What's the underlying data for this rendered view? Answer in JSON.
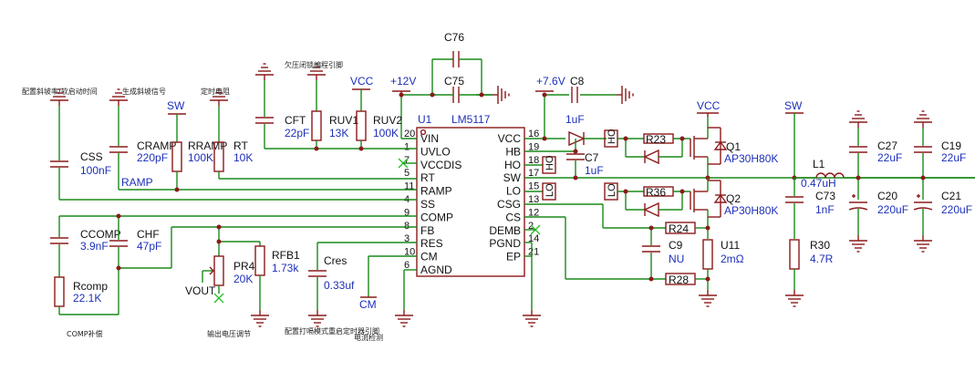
{
  "ic": {
    "ref": "U1",
    "part": "LM5117",
    "left_pins": [
      {
        "num": "20",
        "name": "VIN"
      },
      {
        "num": "1",
        "name": "UVLO"
      },
      {
        "num": "7",
        "name": "VCCDIS"
      },
      {
        "num": "5",
        "name": "RT"
      },
      {
        "num": "11",
        "name": "RAMP"
      },
      {
        "num": "4",
        "name": "SS"
      },
      {
        "num": "9",
        "name": "COMP"
      },
      {
        "num": "8",
        "name": "FB"
      },
      {
        "num": "3",
        "name": "RES"
      },
      {
        "num": "10",
        "name": "CM"
      },
      {
        "num": "6",
        "name": "AGND"
      }
    ],
    "right_pins": [
      {
        "num": "16",
        "name": "VCC"
      },
      {
        "num": "19",
        "name": "HB"
      },
      {
        "num": "18",
        "name": "HO"
      },
      {
        "num": "17",
        "name": "SW"
      },
      {
        "num": "15",
        "name": "LO"
      },
      {
        "num": "13",
        "name": "CSG"
      },
      {
        "num": "12",
        "name": "CS"
      },
      {
        "num": "2",
        "name": "DEMB"
      },
      {
        "num": "14",
        "name": "PGND"
      },
      {
        "num": "21",
        "name": "EP"
      }
    ]
  },
  "components": {
    "c76": {
      "ref": "C76"
    },
    "c75": {
      "ref": "C75"
    },
    "c8": {
      "ref": "C8",
      "value": "1uF"
    },
    "c7": {
      "ref": "C7",
      "value": "1uF"
    },
    "css": {
      "ref": "CSS",
      "value": "100nF"
    },
    "cramp": {
      "ref": "CRAMP",
      "value": "220pF"
    },
    "rramp": {
      "ref": "RRAMP",
      "value": "100K"
    },
    "rt": {
      "ref": "RT",
      "value": "10K"
    },
    "cft": {
      "ref": "CFT",
      "value": "22pF"
    },
    "ruv1": {
      "ref": "RUV1",
      "value": "13K"
    },
    "ruv2": {
      "ref": "RUV2",
      "value": "100K"
    },
    "ccomp": {
      "ref": "CCOMP",
      "value": "3.9nF"
    },
    "chf": {
      "ref": "CHF",
      "value": "47pF"
    },
    "rcomp": {
      "ref": "Rcomp",
      "value": "22.1K"
    },
    "pr4": {
      "ref": "PR4",
      "value": "20K"
    },
    "rfb1": {
      "ref": "RFB1",
      "value": "1.73k"
    },
    "cres": {
      "ref": "Cres",
      "value": "0.33uf"
    },
    "r23": {
      "ref": "R23"
    },
    "r36": {
      "ref": "R36"
    },
    "r24": {
      "ref": "R24"
    },
    "r28": {
      "ref": "R28"
    },
    "c9": {
      "ref": "C9",
      "value": "NU"
    },
    "u11": {
      "ref": "U11",
      "value": "2mΩ"
    },
    "q1": {
      "ref": "Q1",
      "value": "AP30H80K"
    },
    "q2": {
      "ref": "Q2",
      "value": "AP30H80K"
    },
    "l1": {
      "ref": "L1",
      "value": "0.47uH"
    },
    "c73": {
      "ref": "C73",
      "value": "1nF"
    },
    "r30": {
      "ref": "R30",
      "value": "4.7R"
    },
    "c27": {
      "ref": "C27",
      "value": "22uF"
    },
    "c19": {
      "ref": "C19",
      "value": "22uF"
    },
    "c20": {
      "ref": "C20",
      "value": "220uF"
    },
    "c21": {
      "ref": "C21",
      "value": "220uF"
    }
  },
  "nets": {
    "p12v": "+12V",
    "p76v": "+7.6V",
    "vcc1": "VCC",
    "vcc2": "VCC",
    "sw1": "SW",
    "sw2": "SW",
    "ramp": "RAMP",
    "ho1": "HO",
    "ho2": "HO",
    "lo1": "LO",
    "lo2": "LO",
    "vout": "VOUT",
    "cm": "CM"
  },
  "annotations": {
    "ramp_rate": "配置斜坡率/软启动时间",
    "ramp_signal": "生成斜坡信号",
    "timing_r": "定时电阻",
    "uvlo_prog": "欠压闭锁编程引脚",
    "comp": "COMP补偿",
    "vout_adj": "输出电压调节",
    "res_timer_1": "配置打嗝模式重启定时器引脚",
    "current_sense": "电流检测"
  },
  "colors": {
    "wire": "#1a8a1a",
    "component": "#8b1a1a",
    "value_text": "#1d2fb8",
    "no_connect": "#2ec12e"
  }
}
